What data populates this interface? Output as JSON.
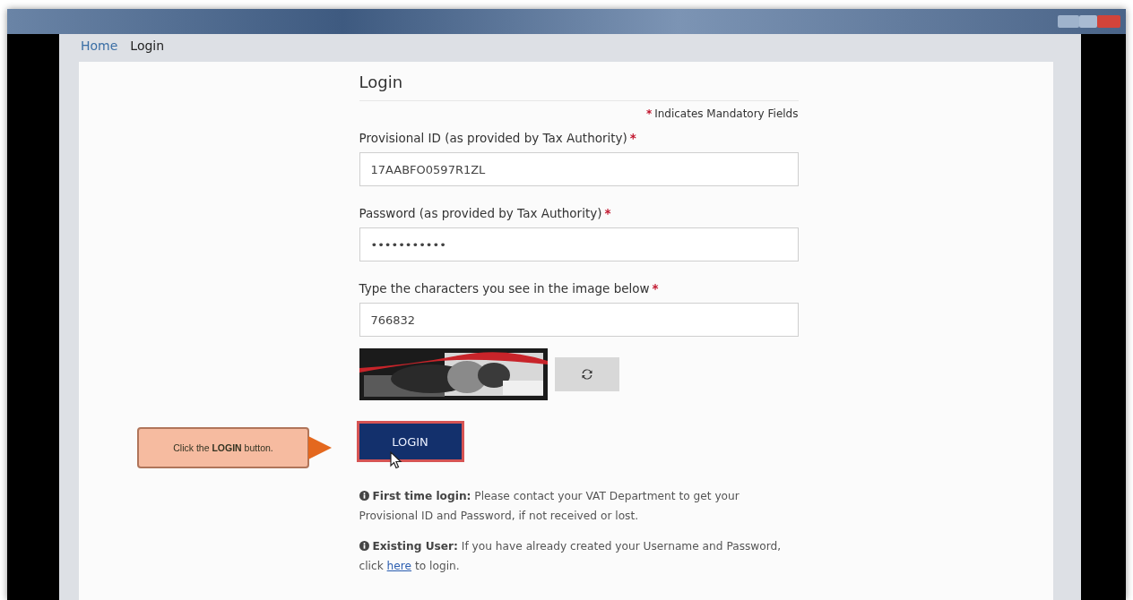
{
  "breadcrumb": [
    {
      "label": "Home",
      "kind": "link"
    },
    {
      "label": "Login",
      "kind": "current"
    }
  ],
  "form": {
    "title": "Login",
    "required_mark": "*",
    "mandatory_note": "Indicates Mandatory Fields",
    "fields": [
      {
        "label": "Provisional ID (as provided by Tax Authority)",
        "value": "17AABFO0597R1ZL",
        "required": true
      },
      {
        "label": "Password (as provided by Tax Authority)",
        "value": "•••••••••••",
        "required": true
      },
      {
        "label": "Type the characters you see in the image below",
        "value": "766832",
        "required": true
      }
    ],
    "login_button": "LOGIN",
    "notes": [
      {
        "title": "First time login:",
        "text": "Please contact your VAT Department to get your Provisional ID and Password, if not received or lost."
      },
      {
        "title": "Existing User:",
        "text": "If you have already created your Username and Password, click ",
        "link": "here",
        "after": " to login."
      }
    ]
  },
  "callout": {
    "text": "Click the **LOGIN** button."
  }
}
